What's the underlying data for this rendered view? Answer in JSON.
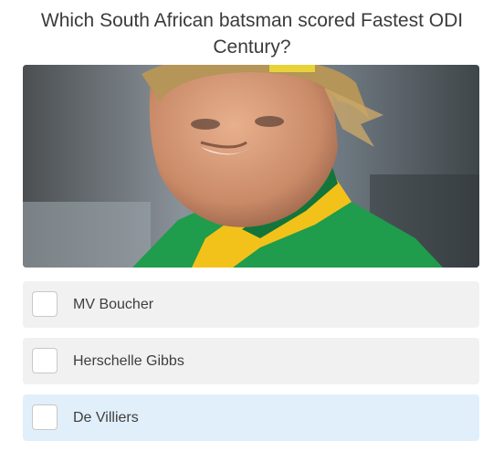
{
  "quiz": {
    "question": "Which South African batsman scored Fastest ODI Century?",
    "image": {
      "icon": "cricketer-photo",
      "jersey_color": "#1f9c4c",
      "collar_color": "#f2c21b"
    },
    "options": [
      {
        "label": "MV Boucher",
        "selected": false,
        "highlighted": false
      },
      {
        "label": "Herschelle Gibbs",
        "selected": false,
        "highlighted": false
      },
      {
        "label": "De Villiers",
        "selected": false,
        "highlighted": true
      }
    ],
    "colors": {
      "option_bg": "#f1f1f1",
      "option_highlight_bg": "#e1effb"
    }
  }
}
